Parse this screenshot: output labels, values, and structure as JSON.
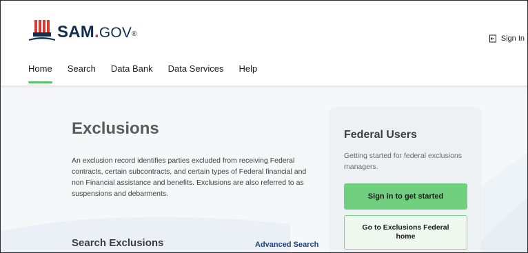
{
  "header": {
    "logo": {
      "sam": "SAM",
      "dot": ".",
      "gov": "GOV",
      "tm": "®"
    },
    "sign_in_label": "Sign In"
  },
  "nav": {
    "items": [
      {
        "label": "Home",
        "active": true
      },
      {
        "label": "Search"
      },
      {
        "label": "Data Bank"
      },
      {
        "label": "Data Services"
      },
      {
        "label": "Help"
      }
    ]
  },
  "main": {
    "title": "Exclusions",
    "description": "An exclusion record identifies parties excluded from receiving Federal contracts, certain subcontracts, and certain types of Federal financial and non Financial assistance and benefits. Exclusions are also referred to as suspensions and debarments.",
    "search_heading": "Search Exclusions",
    "advanced_search_label": "Advanced Search"
  },
  "federal_card": {
    "title": "Federal Users",
    "subtitle": "Getting started for federal exclusions managers.",
    "primary_button": "Sign in to get started",
    "secondary_button": "Go to Exclusions Federal home"
  },
  "icons": [
    "sam-logo-icon",
    "sign-in-icon"
  ],
  "colors": {
    "brand_navy": "#112e51",
    "brand_red": "#d83933",
    "accent_green": "#70d080",
    "nav_underline": "#5dc26f",
    "link_blue": "#1a4480"
  }
}
